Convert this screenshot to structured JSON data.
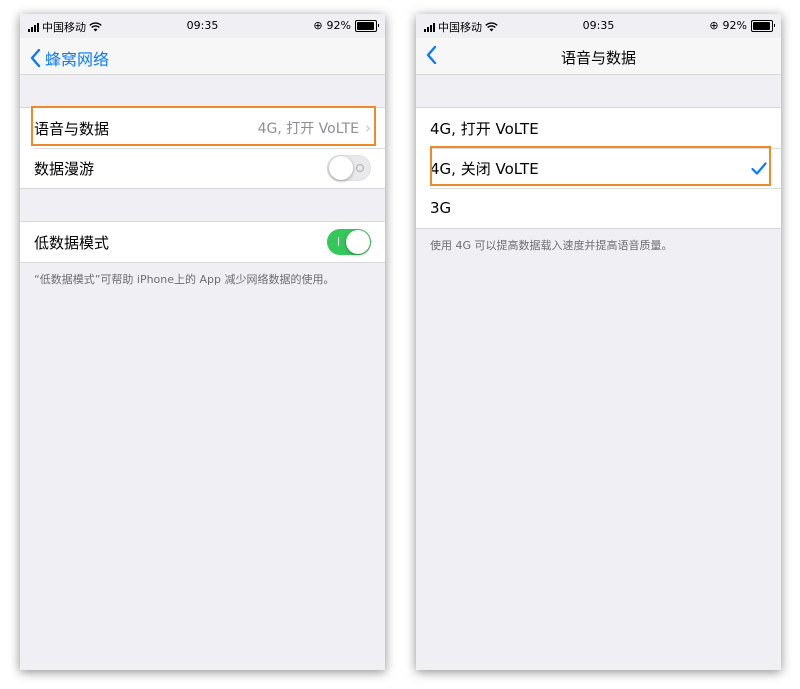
{
  "status_bar": {
    "carrier": "中国移动",
    "time": "09:35",
    "battery": "92%"
  },
  "left_screen": {
    "back_label": "蜂窝网络",
    "rows": {
      "voice_data": {
        "label": "语音与数据",
        "value": "4G, 打开 VoLTE"
      },
      "roaming": {
        "label": "数据漫游",
        "on": false
      },
      "low_data": {
        "label": "低数据模式",
        "on": true
      }
    },
    "footnote": "“低数据模式”可帮助 iPhone上的 App 减少网络数据的使用。"
  },
  "right_screen": {
    "title": "语音与数据",
    "options": [
      "4G, 打开 VoLTE",
      "4G, 关闭 VoLTE",
      "3G"
    ],
    "selected_index": 1,
    "footnote": "使用 4G 可以提高数据载入速度并提高语音质量。"
  },
  "colors": {
    "accent": "#0a7aff",
    "toggle_on": "#34c759",
    "highlight": "#f08a28"
  }
}
